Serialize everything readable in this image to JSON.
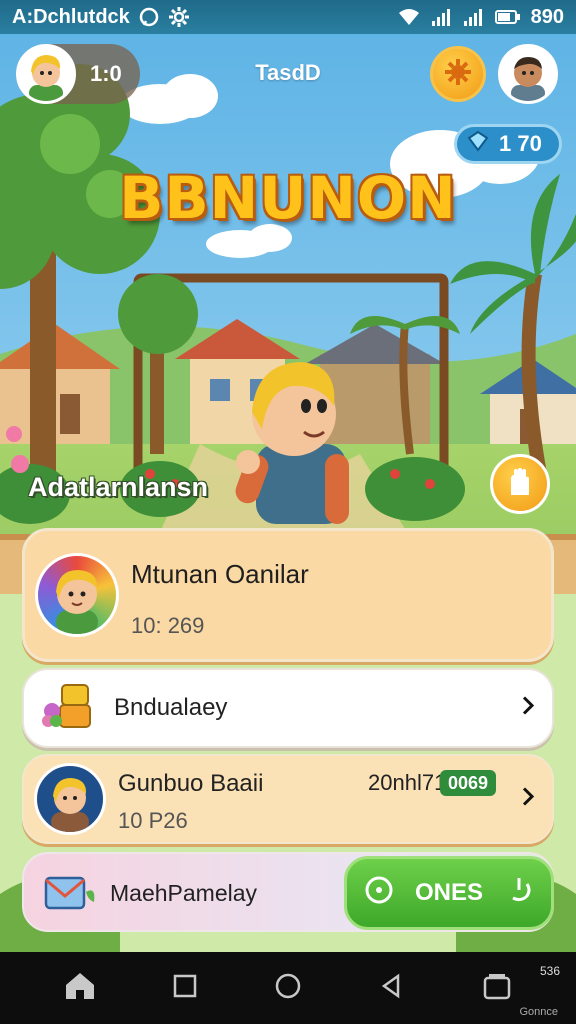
{
  "status_bar": {
    "app_name": "A:Dchlutdck",
    "time": "890",
    "icons": [
      "whatsapp-icon",
      "gear-icon",
      "wifi-icon",
      "signal-icon",
      "signal-icon",
      "battery-icon"
    ]
  },
  "hud": {
    "score": "1:0",
    "title": "TasdD",
    "gems": "1 70"
  },
  "game": {
    "logo": "BBNUNON",
    "location": "Adatlarnlansn"
  },
  "player_card": {
    "name": "Mtunan Oanilar",
    "sub": "10: 269"
  },
  "item_card": {
    "label": "Bndualaey"
  },
  "friend_card": {
    "name": "Gunbuo Baaii",
    "sub": "10 P26",
    "stat": "20nhl71",
    "badge": "0069"
  },
  "message_card": {
    "label": "MaehPamelay",
    "play_label": "ONES"
  },
  "nav_bar": {
    "corner_top": "536",
    "corner_bottom": "Gonnce"
  },
  "colors": {
    "accent_orange": "#f29a15",
    "play_green": "#3ea82a",
    "card_peach": "#fbd9a4",
    "sky_blue": "#7cc4ea"
  }
}
